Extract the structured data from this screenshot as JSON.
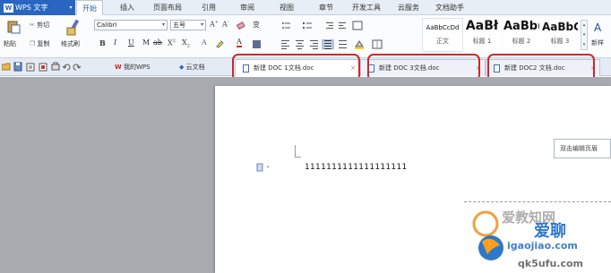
{
  "app": {
    "name": "WPS 文字",
    "logo_letter": "W"
  },
  "menu": {
    "tabs": [
      "开始",
      "插入",
      "页面布局",
      "引用",
      "审阅",
      "视图",
      "章节",
      "开发工具",
      "云服务",
      "文档助手"
    ],
    "active": "开始"
  },
  "ribbon": {
    "paste_label": "粘贴",
    "cut_label": "剪切",
    "copy_label": "复制",
    "format_painter_label": "格式刷",
    "font_name": "Calibri",
    "font_size": "五号",
    "style_gallery": [
      {
        "sample": "AaBbCcDd",
        "name": "正文"
      },
      {
        "sample": "AaBł",
        "name": "标题 1"
      },
      {
        "sample": "AaBb(",
        "name": "标题 2"
      },
      {
        "sample": "AaBbC",
        "name": "标题 3"
      }
    ],
    "new_style_label": "新样"
  },
  "quickbar": {
    "my_wps_label": "我的WPS",
    "cloud_doc_label": "云文档"
  },
  "doc_tabs": [
    {
      "label": "新建 DOC 1文档.doc",
      "active": true
    },
    {
      "label": "新建 DOC 3文档.doc",
      "active": false
    },
    {
      "label": "新建 DOC2 文档.doc",
      "active": false
    }
  ],
  "document": {
    "body_text": "1111111111111111111",
    "header_tooltip": "双击编辑页眉"
  },
  "watermark": {
    "site": "igaojiao.com",
    "site_bottom": "qk5ufu.com",
    "brand_top": "爱教知网",
    "brand_right": "爱聊"
  },
  "colors": {
    "accent": "#2866c2",
    "highlight_ring": "#d0262a",
    "workspace": "#a7aaae"
  }
}
